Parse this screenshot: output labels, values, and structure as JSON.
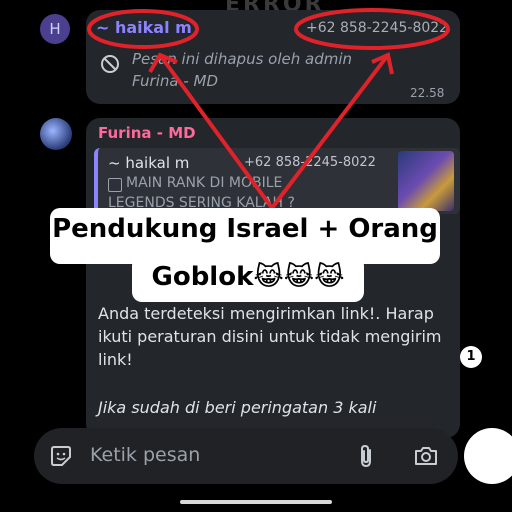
{
  "colors": {
    "background": "#000000",
    "bubble": "#23262b",
    "sender_purple": "#8c83ff",
    "sender_pink": "#ff6a9a",
    "annotation_red": "#e0222a",
    "caption_bg": "#ffffff"
  },
  "watermark": "ERROR",
  "message1": {
    "avatar_letter": "H",
    "sender": "~ haikal m",
    "phone": "+62 858-2245-8022",
    "deleted_text": "Pesan ini dihapus oleh admin",
    "deleted_by": "Furina - MD",
    "time": "22.58"
  },
  "message2": {
    "sender": "Furina - MD",
    "quote": {
      "sender": "~ haikal m",
      "phone": "+62 858-2245-8022",
      "line1": "MAIN RANK DI MOBILE",
      "line2": "LEGENDS SERING KALAH ?"
    },
    "body": "Anda terdeteksi mengirimkan link!. Harap ikuti peraturan disini untuk tidak mengirim link!",
    "warning": "Jika sudah di beri peringatan 3 kali"
  },
  "caption": {
    "line1": "Pendukung Israel + Orang",
    "line2": "Goblok😹😹😹"
  },
  "scroll_badge": "1",
  "composer": {
    "placeholder": "Ketik pesan"
  }
}
